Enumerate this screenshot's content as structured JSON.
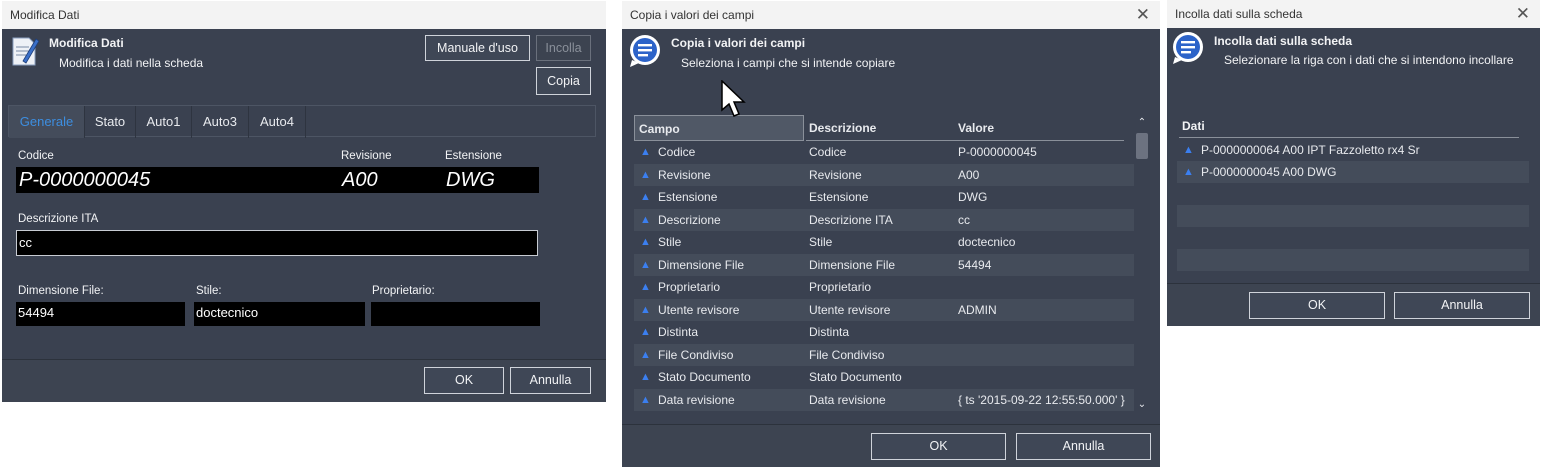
{
  "modifica": {
    "title": "Modifica Dati",
    "header_title": "Modifica Dati",
    "header_subtitle": "Modifica i dati nella scheda",
    "manual_button": "Manuale d'uso",
    "paste_button": "Incolla",
    "copy_button": "Copia",
    "tabs": [
      "Generale",
      "Stato",
      "Auto1",
      "Auto3",
      "Auto4"
    ],
    "codice_label": "Codice",
    "revisione_label": "Revisione",
    "estensione_label": "Estensione",
    "codice_value": "P-0000000045",
    "revisione_value": "A00",
    "estensione_value": "DWG",
    "descrizione_label": "Descrizione ITA",
    "descrizione_value": "cc",
    "dimensione_label": "Dimensione File:",
    "stile_label": "Stile:",
    "proprietario_label": "Proprietario:",
    "dimensione_value": "54494",
    "stile_value": "doctecnico",
    "proprietario_value": "",
    "ok_button": "OK",
    "cancel_button": "Annulla"
  },
  "copia": {
    "title": "Copia i valori dei campi",
    "header_title": "Copia i valori dei campi",
    "header_subtitle": "Seleziona i campi che si intende copiare",
    "columns": [
      "Campo",
      "Descrizione",
      "Valore"
    ],
    "rows": [
      {
        "campo": "Codice",
        "descrizione": "Codice",
        "valore": "P-0000000045"
      },
      {
        "campo": "Revisione",
        "descrizione": "Revisione",
        "valore": "A00"
      },
      {
        "campo": "Estensione",
        "descrizione": "Estensione",
        "valore": "DWG"
      },
      {
        "campo": "Descrizione",
        "descrizione": "Descrizione ITA",
        "valore": "cc"
      },
      {
        "campo": "Stile",
        "descrizione": "Stile",
        "valore": "doctecnico"
      },
      {
        "campo": "Dimensione File",
        "descrizione": "Dimensione File",
        "valore": "54494"
      },
      {
        "campo": "Proprietario",
        "descrizione": "Proprietario",
        "valore": ""
      },
      {
        "campo": "Utente revisore",
        "descrizione": "Utente revisore",
        "valore": "ADMIN"
      },
      {
        "campo": "Distinta",
        "descrizione": "Distinta",
        "valore": ""
      },
      {
        "campo": "File Condiviso",
        "descrizione": "File Condiviso",
        "valore": ""
      },
      {
        "campo": "Stato Documento",
        "descrizione": "Stato Documento",
        "valore": ""
      },
      {
        "campo": "Data revisione",
        "descrizione": "Data revisione",
        "valore": "{ ts '2015-09-22 12:55:50.000' }"
      }
    ],
    "ok_button": "OK",
    "cancel_button": "Annulla"
  },
  "incolla": {
    "title": "Incolla dati sulla scheda",
    "header_title": "Incolla dati sulla scheda",
    "header_subtitle": "Selezionare la riga con i dati che si intendono incollare",
    "column": "Dati",
    "rows": [
      "P-0000000064 A00 IPT Fazzoletto rx4 Sr",
      "P-0000000045 A00 DWG"
    ],
    "ok_button": "OK",
    "cancel_button": "Annulla"
  },
  "colors": {
    "accent": "#3d8ee0",
    "window_bg": "#3a4150",
    "field_bg": "#000000",
    "row_icon": "#3b7ff0"
  }
}
